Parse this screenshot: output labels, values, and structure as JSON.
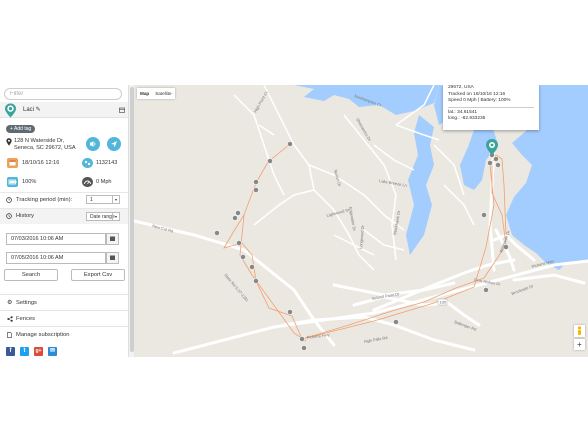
{
  "filter": {
    "placeholder": "Filter"
  },
  "device": {
    "name": "Laci",
    "add_tag_label": "+ Add tag"
  },
  "address": {
    "line1": "128 N Waterside Dr,",
    "line2": "Seneca, SC 29672, USA"
  },
  "stats": {
    "datetime": "18/10/16 12:16",
    "steps": "1132143",
    "battery": "100%",
    "speed": "0 Mph"
  },
  "tracking": {
    "label": "Tracking period (min):",
    "value": "1"
  },
  "history": {
    "label": "History",
    "range_value": "Date range"
  },
  "dates": {
    "from": "07/03/2016 10:06 AM",
    "to": "07/05/2016 10:06 AM"
  },
  "buttons": {
    "search": "Search",
    "export": "Export Csv"
  },
  "menu": {
    "settings": "Settings",
    "fences": "Fences",
    "subscription": "Manage subscription"
  },
  "social": [
    "f",
    "t",
    "g+",
    "✉"
  ],
  "map": {
    "type_map": "Map",
    "type_satellite": "Satellite",
    "zoom_in": "+",
    "roads": {
      "r1": "Northampton Ct",
      "r2": "Shoreacres Dr",
      "r3": "Lake Breeze Ln",
      "r4": "Lightwood Dr",
      "r5": "Edgewater Dr",
      "r6": "New Cut Rd",
      "r7": "State Rd S-37-1281",
      "r8": "Pickens Hwy",
      "r9": "Fern Hollow Dr",
      "r10": "Waterside Dr",
      "r11": "Brookside Dr",
      "r12": "Ballenger Rd",
      "r13": "High Falls Rd",
      "r14": "Sebrell Point Dr",
      "r15": "Norton Dr",
      "r16": "Longwood Dr",
      "r17": "Blackhawk Dr",
      "r18": "Pickens Hwy ",
      "r19": "High Point Ct"
    },
    "highway": "130"
  },
  "info_popup": {
    "line0": "29672, USA",
    "tracked": "Tracked on 18/10/16 12:16",
    "speed_battery": "Speed 0 Mph | Battery: 100%",
    "lat": "lat.: 34.61541",
    "long": "long.: -82.933235"
  },
  "colors": {
    "accent": "#52b5d9",
    "water": "#a3ccff",
    "land": "#ebe8e2",
    "track": "#f0a070"
  }
}
